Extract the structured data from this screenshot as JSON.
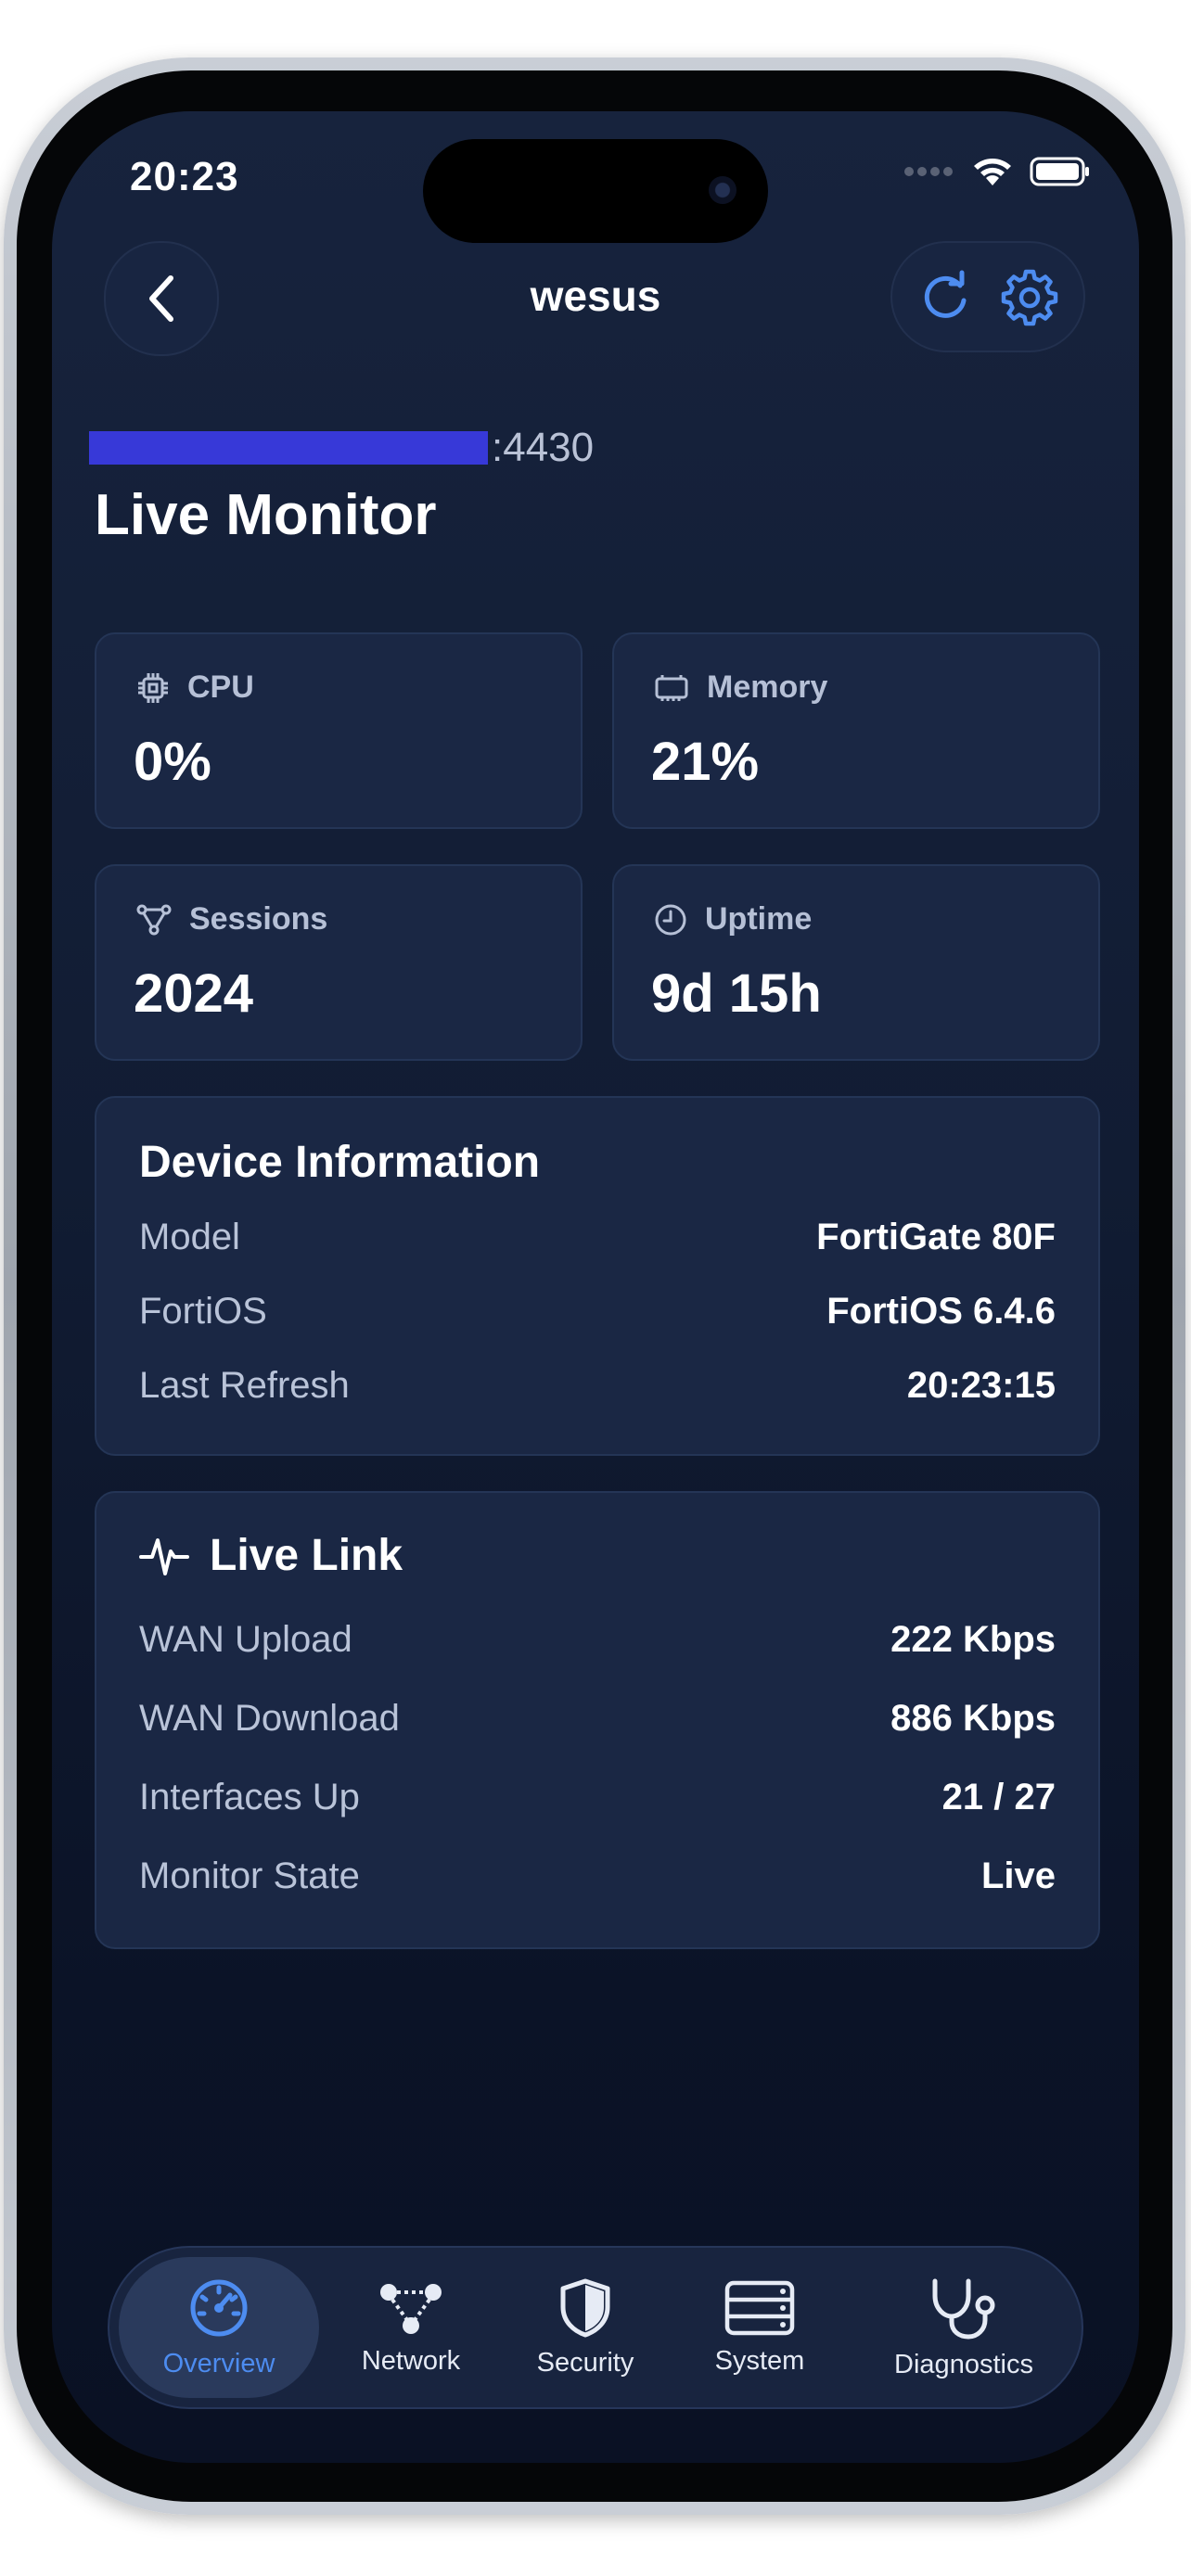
{
  "status_bar": {
    "time": "20:23"
  },
  "nav": {
    "title": "wesus"
  },
  "header": {
    "host_suffix": ":4430",
    "title": "Live Monitor"
  },
  "stats": [
    {
      "label": "CPU",
      "value": "0%",
      "icon": "cpu-icon"
    },
    {
      "label": "Memory",
      "value": "21%",
      "icon": "memory-icon"
    },
    {
      "label": "Sessions",
      "value": "2024",
      "icon": "sessions-icon"
    },
    {
      "label": "Uptime",
      "value": "9d 15h",
      "icon": "clock-icon"
    }
  ],
  "device_info": {
    "title": "Device Information",
    "rows": [
      {
        "label": "Model",
        "value": "FortiGate 80F"
      },
      {
        "label": "FortiOS",
        "value": "FortiOS 6.4.6"
      },
      {
        "label": "Last Refresh",
        "value": "20:23:15"
      }
    ]
  },
  "live_link": {
    "title": "Live Link",
    "rows": [
      {
        "label": "WAN Upload",
        "value": "222 Kbps"
      },
      {
        "label": "WAN Download",
        "value": "886 Kbps"
      },
      {
        "label": "Interfaces Up",
        "value": "21 / 27"
      },
      {
        "label": "Monitor State",
        "value": "Live"
      }
    ]
  },
  "tabs": [
    {
      "label": "Overview",
      "icon": "speedometer-icon",
      "active": true
    },
    {
      "label": "Network",
      "icon": "network-icon",
      "active": false
    },
    {
      "label": "Security",
      "icon": "shield-icon",
      "active": false
    },
    {
      "label": "System",
      "icon": "server-icon",
      "active": false
    },
    {
      "label": "Diagnostics",
      "icon": "stethoscope-icon",
      "active": false
    }
  ],
  "colors": {
    "background": "#111c33",
    "card": "#1a2744",
    "accent": "#4d8cf0",
    "redaction": "#3739d8"
  }
}
